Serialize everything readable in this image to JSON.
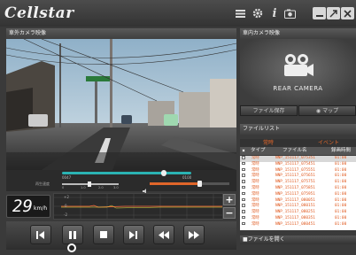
{
  "app": {
    "title": "Cellstar"
  },
  "titlebar": {
    "icons": [
      "list-icon",
      "gear-icon",
      "info-icon",
      "camera-snapshot-icon"
    ],
    "window_buttons": [
      "minimize-icon",
      "maximize-icon",
      "close-icon"
    ]
  },
  "front": {
    "title": "車外カメラ映像"
  },
  "rear": {
    "title": "車内カメラ映像",
    "label": "REAR CAMERA"
  },
  "timeline": {
    "start_time": "0047",
    "end_time": "0100",
    "progress": 0.79,
    "volume": 0.62,
    "left_label": "再生速度",
    "ticks": [
      "0",
      "1.0",
      "2.0",
      "3.0"
    ]
  },
  "speed": {
    "value": "29",
    "unit": "km/h"
  },
  "graph": {
    "labels": [
      "+2",
      "0",
      "-2"
    ]
  },
  "controls": [
    "skip-previous-icon",
    "pause-icon",
    "stop-icon",
    "frame-forward-icon",
    "rewind-icon",
    "fast-forward-icon"
  ],
  "buttons": {
    "map": "マップ",
    "left": "ファイル保存"
  },
  "filelist": {
    "title": "ファイルリスト",
    "tabs": [
      "常時",
      "イベント"
    ],
    "columns": [
      "タイプ",
      "ファイル名",
      "録画時間"
    ],
    "rows": [
      {
        "type": "常時",
        "name": "NNP_151117_075351",
        "dur": "01:00"
      },
      {
        "type": "常時",
        "name": "NNP_151117_075451",
        "dur": "01:00"
      },
      {
        "type": "常時",
        "name": "NNP_151117_075551",
        "dur": "01:00"
      },
      {
        "type": "常時",
        "name": "NNP_151117_075651",
        "dur": "01:00"
      },
      {
        "type": "常時",
        "name": "NNP_151117_075751",
        "dur": "01:00"
      },
      {
        "type": "常時",
        "name": "NNP_151117_075851",
        "dur": "01:00"
      },
      {
        "type": "常時",
        "name": "NNP_151117_075951",
        "dur": "01:00"
      },
      {
        "type": "常時",
        "name": "NNP_151117_080051",
        "dur": "01:00"
      },
      {
        "type": "常時",
        "name": "NNP_151117_080151",
        "dur": "01:00"
      },
      {
        "type": "常時",
        "name": "NNP_151117_080251",
        "dur": "01:00"
      },
      {
        "type": "常時",
        "name": "NNP_151117_080351",
        "dur": "01:00"
      },
      {
        "type": "常時",
        "name": "NNP_151117_080451",
        "dur": "01:00"
      }
    ],
    "open_button": "ファイルを開く"
  }
}
